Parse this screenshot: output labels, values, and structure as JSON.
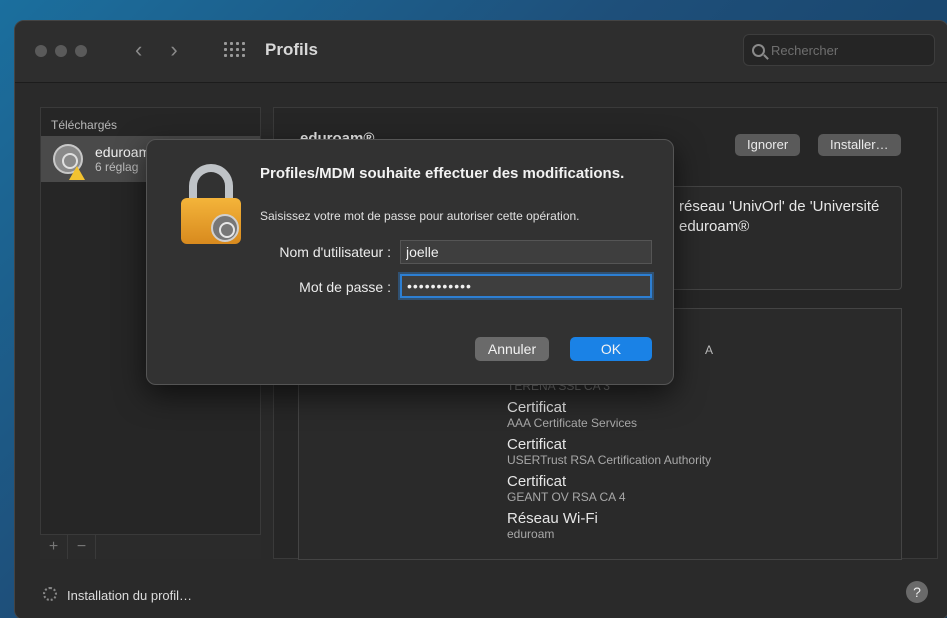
{
  "window": {
    "title": "Profils"
  },
  "search": {
    "placeholder": "Rechercher"
  },
  "sidebar": {
    "header": "Téléchargés",
    "items": [
      {
        "name": "eduroam",
        "subtitle": "6 réglag"
      }
    ],
    "add": "+",
    "remove": "−"
  },
  "main": {
    "profile_title": "eduroam®",
    "ignore_label": "Ignorer",
    "install_label": "Installer…",
    "description_lines": [
      "réseau 'UnivOrl' de 'Université",
      "eduroam®"
    ],
    "partial_a": "A",
    "faded_line": "TERENA SSL CA 3",
    "entries": [
      {
        "title": "Certificat",
        "detail": "AAA Certificate Services"
      },
      {
        "title": "Certificat",
        "detail": "USERTrust RSA Certification Authority"
      },
      {
        "title": "Certificat",
        "detail": "GEANT OV RSA CA 4"
      },
      {
        "title": "Réseau Wi-Fi",
        "detail": "eduroam"
      }
    ]
  },
  "status": {
    "text": "Installation du profil…",
    "help": "?"
  },
  "dialog": {
    "title": "Profiles/MDM souhaite effectuer des modifications.",
    "message": "Saisissez votre mot de passe pour autoriser cette opération.",
    "username_label": "Nom d'utilisateur :",
    "username_value": "joelle",
    "password_label": "Mot de passe :",
    "password_value": "•••••••••••",
    "cancel_label": "Annuler",
    "ok_label": "OK"
  }
}
